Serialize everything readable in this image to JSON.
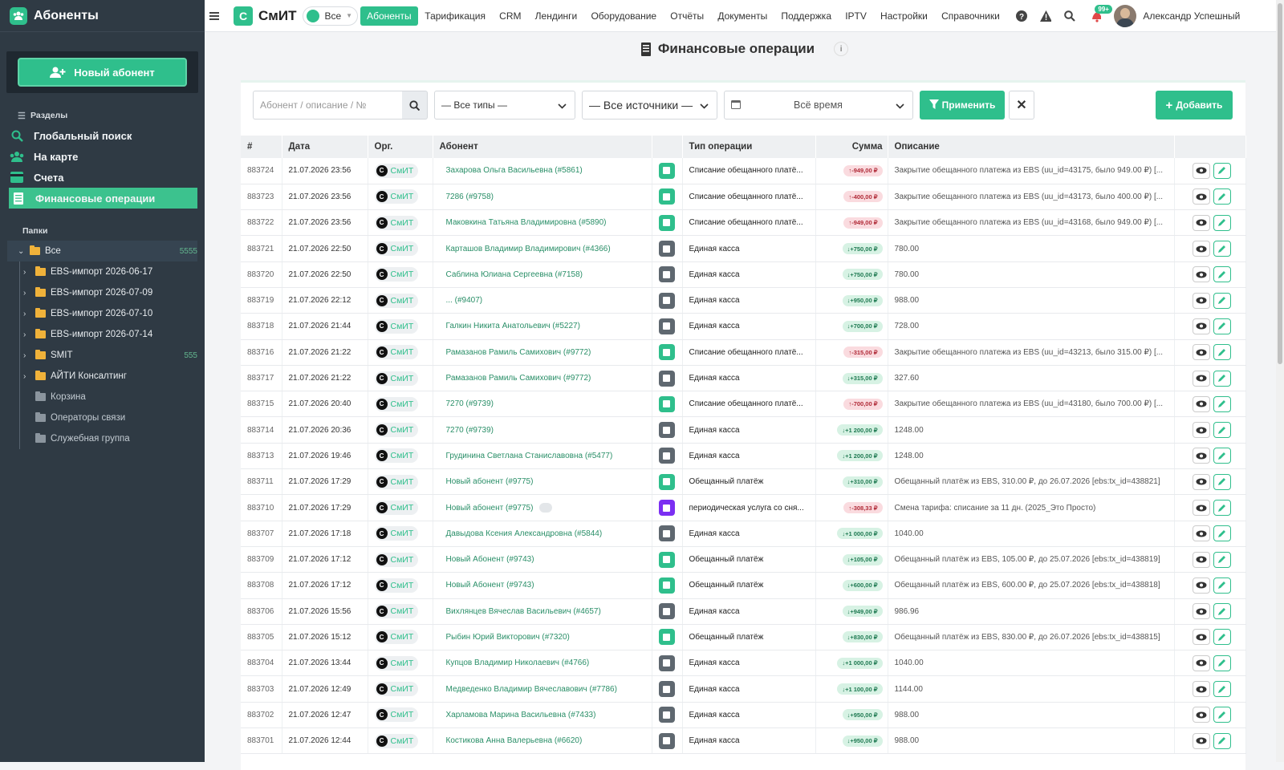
{
  "sidebar": {
    "title": "Абоненты",
    "new_button": "Новый абонент",
    "sections_label": "Разделы",
    "nav": [
      {
        "label": "Глобальный поиск",
        "icon": "search-icon"
      },
      {
        "label": "На карте",
        "icon": "map-icon"
      },
      {
        "label": "Счета",
        "icon": "invoice-icon"
      },
      {
        "label": "Финансовые операции",
        "icon": "ledger-icon",
        "active": true
      }
    ],
    "folders_label": "Папки",
    "folders": [
      {
        "label": "Все",
        "count": "5555"
      },
      {
        "label": "EBS-импорт 2026-06-17"
      },
      {
        "label": "EBS-импорт 2026-07-09"
      },
      {
        "label": "EBS-импорт 2026-07-10"
      },
      {
        "label": "EBS-импорт 2026-07-14"
      },
      {
        "label": "SMIT",
        "count": "555"
      },
      {
        "label": "АЙТИ Консалтинг"
      },
      {
        "label": "Корзина"
      },
      {
        "label": "Операторы связи"
      },
      {
        "label": "Служебная группа"
      }
    ]
  },
  "topbar": {
    "brand": "СмИТ",
    "brand_letter": "С",
    "scope": "Все",
    "menu": [
      "Абоненты",
      "Тарификация",
      "CRM",
      "Лендинги",
      "Оборудование",
      "Отчёты",
      "Документы",
      "Поддержка",
      "IPTV",
      "Настройки",
      "Справочники"
    ],
    "notif_badge": "99+",
    "user": "Александр Успешный"
  },
  "page": {
    "title": "Финансовые операции",
    "info": "i"
  },
  "filters": {
    "search_placeholder": "Абонент / описание / №",
    "type": "— Все типы —",
    "source": "— Все источники —",
    "period": "Всё время",
    "apply": "Применить",
    "add": "Добавить"
  },
  "table": {
    "headers": [
      "#",
      "Дата",
      "Орг.",
      "Абонент",
      "",
      "Тип операции",
      "Сумма",
      "Описание",
      ""
    ],
    "org_label": "СмИТ",
    "rows": [
      {
        "id": "883724",
        "date": "21.07.2026 23:56",
        "abonent": "Захарова Ольга Васильевна (#5861)",
        "tcolor": "#2fbf8c",
        "type": "Списание обещанного платё...",
        "sign": "neg",
        "amount": "-949,00 ₽",
        "desc": "Закрытие обещанного платежа из EBS (uu_id=43175, было 949.00 ₽) [..."
      },
      {
        "id": "883723",
        "date": "21.07.2026 23:56",
        "abonent": "7286 (#9758)",
        "tcolor": "#2fbf8c",
        "type": "Списание обещанного платё...",
        "sign": "neg",
        "amount": "-400,00 ₽",
        "desc": "Закрытие обещанного платежа из EBS (uu_id=43173, было 400.00 ₽) [..."
      },
      {
        "id": "883722",
        "date": "21.07.2026 23:56",
        "abonent": "Маковкина Татьяна Владимировна (#5890)",
        "tcolor": "#2fbf8c",
        "type": "Списание обещанного платё...",
        "sign": "neg",
        "amount": "-949,00 ₽",
        "desc": "Закрытие обещанного платежа из EBS (uu_id=43168, было 949.00 ₽) [..."
      },
      {
        "id": "883721",
        "date": "21.07.2026 22:50",
        "abonent": "Карташов Владимир Владимирович (#4366)",
        "tcolor": "#5f6870",
        "type": "Единая касса",
        "sign": "pos",
        "amount": "+750,00 ₽",
        "desc": "780.00"
      },
      {
        "id": "883720",
        "date": "21.07.2026 22:50",
        "abonent": "Саблина Юлиана Сергеевна (#7158)",
        "tcolor": "#5f6870",
        "type": "Единая касса",
        "sign": "pos",
        "amount": "+750,00 ₽",
        "desc": "780.00"
      },
      {
        "id": "883719",
        "date": "21.07.2026 22:12",
        "abonent": "... (#9407)",
        "tcolor": "#5f6870",
        "type": "Единая касса",
        "sign": "pos",
        "amount": "+950,00 ₽",
        "desc": "988.00"
      },
      {
        "id": "883718",
        "date": "21.07.2026 21:44",
        "abonent": "Галкин Никита Анатольевич (#5227)",
        "tcolor": "#5f6870",
        "type": "Единая касса",
        "sign": "pos",
        "amount": "+700,00 ₽",
        "desc": "728.00"
      },
      {
        "id": "883716",
        "date": "21.07.2026 21:22",
        "abonent": "Рамазанов Рамиль Самихович (#9772)",
        "tcolor": "#2fbf8c",
        "type": "Списание обещанного платё...",
        "sign": "neg",
        "amount": "-315,00 ₽",
        "desc": "Закрытие обещанного платежа из EBS (uu_id=43213, было 315.00 ₽) [..."
      },
      {
        "id": "883717",
        "date": "21.07.2026 21:22",
        "abonent": "Рамазанов Рамиль Самихович (#9772)",
        "tcolor": "#5f6870",
        "type": "Единая касса",
        "sign": "pos",
        "amount": "+315,00 ₽",
        "desc": "327.60"
      },
      {
        "id": "883715",
        "date": "21.07.2026 20:40",
        "abonent": "7270 (#9739)",
        "tcolor": "#2fbf8c",
        "type": "Списание обещанного платё...",
        "sign": "neg",
        "amount": "-700,00 ₽",
        "desc": "Закрытие обещанного платежа из EBS (uu_id=43180, было 700.00 ₽) [..."
      },
      {
        "id": "883714",
        "date": "21.07.2026 20:36",
        "abonent": "7270 (#9739)",
        "tcolor": "#5f6870",
        "type": "Единая касса",
        "sign": "pos",
        "amount": "+1 200,00 ₽",
        "desc": "1248.00"
      },
      {
        "id": "883713",
        "date": "21.07.2026 19:46",
        "abonent": "Грудинина Светлана Станиславовна (#5477)",
        "tcolor": "#5f6870",
        "type": "Единая касса",
        "sign": "pos",
        "amount": "+1 200,00 ₽",
        "desc": "1248.00"
      },
      {
        "id": "883711",
        "date": "21.07.2026 17:29",
        "abonent": "Новый абонент (#9775)",
        "tcolor": "#2fbf8c",
        "type": "Обещанный платёж",
        "sign": "pos",
        "amount": "+310,00 ₽",
        "desc": "Обещанный платёж из EBS, 310.00 ₽, до 26.07.2026 [ebs:tx_id=438821]"
      },
      {
        "id": "883710",
        "date": "21.07.2026 17:29",
        "abonent": "Новый абонент (#9775)",
        "tag": true,
        "tcolor": "#7b2ff2",
        "type": "периодическая услуга со сня...",
        "sign": "neg",
        "amount": "-308,33 ₽",
        "desc": "Смена тарифа: списание за 11 дн. (2025_Это Просто)"
      },
      {
        "id": "883707",
        "date": "21.07.2026 17:18",
        "abonent": "Давыдова Ксения Александровна (#5844)",
        "tcolor": "#5f6870",
        "type": "Единая касса",
        "sign": "pos",
        "amount": "+1 000,00 ₽",
        "desc": "1040.00"
      },
      {
        "id": "883709",
        "date": "21.07.2026 17:12",
        "abonent": "Новый Абонент (#9743)",
        "tcolor": "#2fbf8c",
        "type": "Обещанный платёж",
        "sign": "pos",
        "amount": "+105,00 ₽",
        "desc": "Обещанный платёж из EBS, 105.00 ₽, до 25.07.2026 [ebs:tx_id=438819]"
      },
      {
        "id": "883708",
        "date": "21.07.2026 17:12",
        "abonent": "Новый Абонент (#9743)",
        "tcolor": "#2fbf8c",
        "type": "Обещанный платёж",
        "sign": "pos",
        "amount": "+600,00 ₽",
        "desc": "Обещанный платёж из EBS, 600.00 ₽, до 25.07.2026 [ebs:tx_id=438818]"
      },
      {
        "id": "883706",
        "date": "21.07.2026 15:56",
        "abonent": "Вихлянцев Вячеслав Васильевич (#4657)",
        "tcolor": "#5f6870",
        "type": "Единая касса",
        "sign": "pos",
        "amount": "+949,00 ₽",
        "desc": "986.96"
      },
      {
        "id": "883705",
        "date": "21.07.2026 15:12",
        "abonent": "Рыбин Юрий Викторович (#7320)",
        "tcolor": "#2fbf8c",
        "type": "Обещанный платёж",
        "sign": "pos",
        "amount": "+830,00 ₽",
        "desc": "Обещанный платёж из EBS, 830.00 ₽, до 26.07.2026 [ebs:tx_id=438815]"
      },
      {
        "id": "883704",
        "date": "21.07.2026 13:44",
        "abonent": "Купцов Владимир Николаевич (#4766)",
        "tcolor": "#5f6870",
        "type": "Единая касса",
        "sign": "pos",
        "amount": "+1 000,00 ₽",
        "desc": "1040.00"
      },
      {
        "id": "883703",
        "date": "21.07.2026 12:49",
        "abonent": "Медведенко Владимир Вячеславович (#7786)",
        "tcolor": "#5f6870",
        "type": "Единая касса",
        "sign": "pos",
        "amount": "+1 100,00 ₽",
        "desc": "1144.00"
      },
      {
        "id": "883702",
        "date": "21.07.2026 12:47",
        "abonent": "Харламова Марина Васильевна (#7433)",
        "tcolor": "#5f6870",
        "type": "Единая касса",
        "sign": "pos",
        "amount": "+950,00 ₽",
        "desc": "988.00"
      },
      {
        "id": "883701",
        "date": "21.07.2026 12:44",
        "abonent": "Костикова Анна Валерьевна (#6620)",
        "tcolor": "#5f6870",
        "type": "Единая касса",
        "sign": "pos",
        "amount": "+950,00 ₽",
        "desc": "988.00"
      }
    ]
  }
}
